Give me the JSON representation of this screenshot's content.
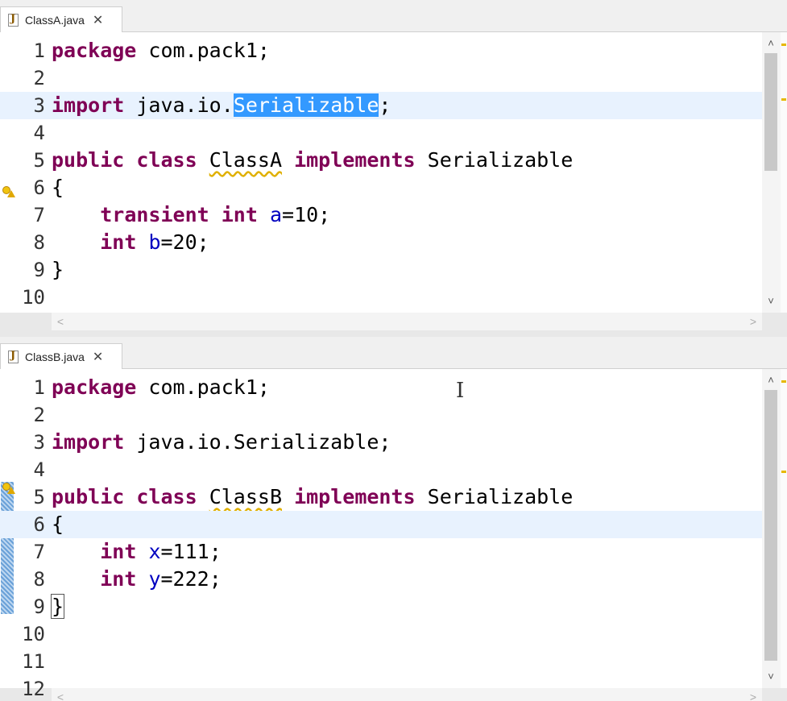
{
  "editor_a": {
    "tab": {
      "label": "ClassA.java",
      "close_glyph": "✕",
      "icon": "java-file-icon"
    },
    "lines": [
      {
        "num": "1"
      },
      {
        "num": "2"
      },
      {
        "num": "3"
      },
      {
        "num": "4"
      },
      {
        "num": "5"
      },
      {
        "num": "6"
      },
      {
        "num": "7"
      },
      {
        "num": "8"
      },
      {
        "num": "9"
      },
      {
        "num": "10"
      }
    ],
    "code": {
      "l1_kw": "package",
      "l1_rest": " com.pack1;",
      "l3_kw": "import",
      "l3_pre": " java.io.",
      "l3_sel": "Serializable",
      "l3_post": ";",
      "l5_kw1": "public",
      "l5_kw2": "class",
      "l5_name": "ClassA",
      "l5_kw3": "implements",
      "l5_iface": "Serializable",
      "l6": "{",
      "l7_kw1": "transient",
      "l7_kw2": "int",
      "l7_var": "a",
      "l7_val": "=10;",
      "l8_kw": "int",
      "l8_var": "b",
      "l8_val": "=20;",
      "l9": "}"
    },
    "current_line": 3,
    "vscroll_position": 0.0
  },
  "editor_b": {
    "tab": {
      "label": "ClassB.java",
      "close_glyph": "✕",
      "icon": "java-file-icon"
    },
    "lines": [
      {
        "num": "1"
      },
      {
        "num": "2"
      },
      {
        "num": "3"
      },
      {
        "num": "4"
      },
      {
        "num": "5"
      },
      {
        "num": "6"
      },
      {
        "num": "7"
      },
      {
        "num": "8"
      },
      {
        "num": "9"
      },
      {
        "num": "10"
      },
      {
        "num": "11"
      },
      {
        "num": "12"
      }
    ],
    "code": {
      "l1_kw": "package",
      "l1_rest": " com.pack1;",
      "l3_kw": "import",
      "l3_rest": " java.io.Serializable;",
      "l5_kw1": "public",
      "l5_kw2": "class",
      "l5_name": "ClassB",
      "l5_kw3": "implements",
      "l5_iface": "Serializable",
      "l6": "{",
      "l7_kw": "int",
      "l7_var": "x",
      "l7_val": "=111;",
      "l8_kw": "int",
      "l8_var": "y",
      "l8_val": "=222;",
      "l9": "}"
    },
    "current_line": 6,
    "vscroll_position": 0.0
  },
  "colors": {
    "keyword": "#7f0055",
    "field": "#0000c0",
    "selection": "#3399ff",
    "current_line": "#e8f2fe",
    "warning": "#e0b000"
  },
  "glyphs": {
    "up": "˄",
    "down": "˅",
    "left": "<",
    "right": ">"
  }
}
